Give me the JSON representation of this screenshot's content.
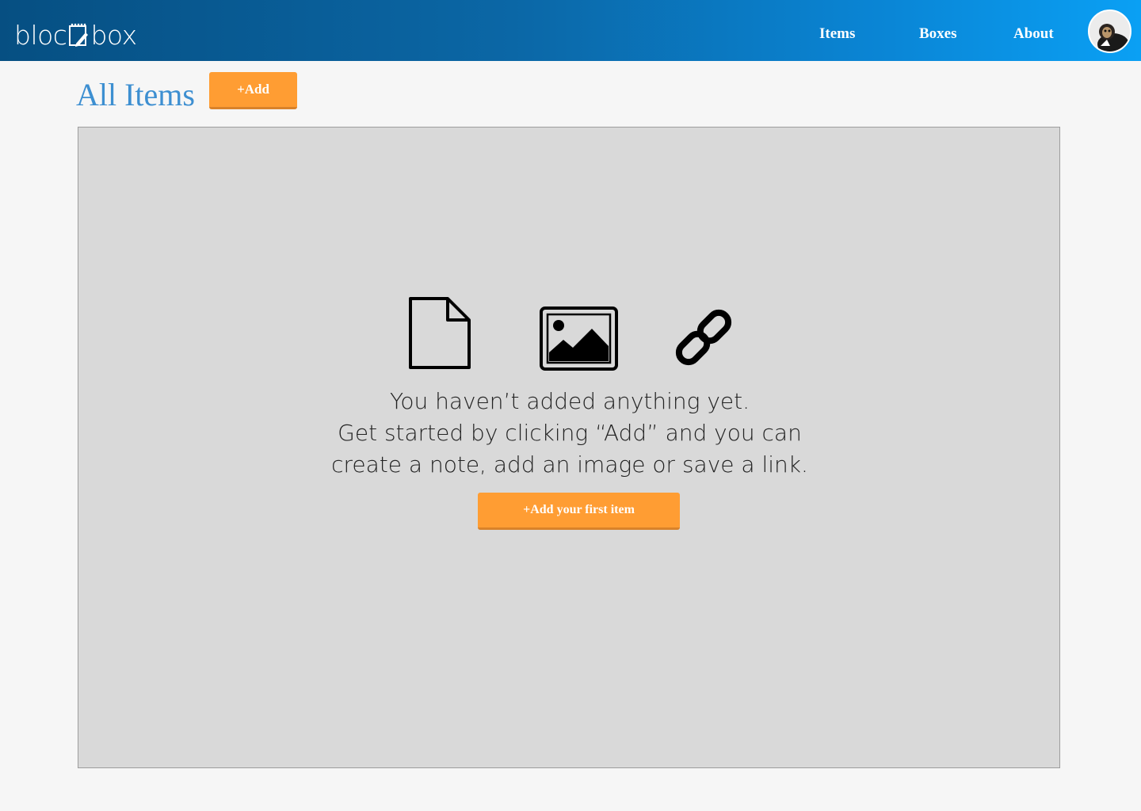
{
  "header": {
    "logo_left": "bloc",
    "logo_right": "box",
    "nav": {
      "items": "Items",
      "boxes": "Boxes",
      "about": "About"
    },
    "gradient_start": "#064f82",
    "gradient_end": "#0aa0f4"
  },
  "main": {
    "title": "All Items",
    "add_button": "+Add",
    "empty_state": {
      "icons": [
        "document-icon",
        "image-icon",
        "link-icon"
      ],
      "line1": "You haven’t added anything yet.",
      "line2": "Get started by clicking “Add” and you can",
      "line3": "create a note, add an image or save a link.",
      "cta": "+Add your first item"
    }
  },
  "colors": {
    "accent_blue": "#3d8fd1",
    "button_orange": "#ff9d33",
    "panel_gray": "#d9d9d9"
  }
}
